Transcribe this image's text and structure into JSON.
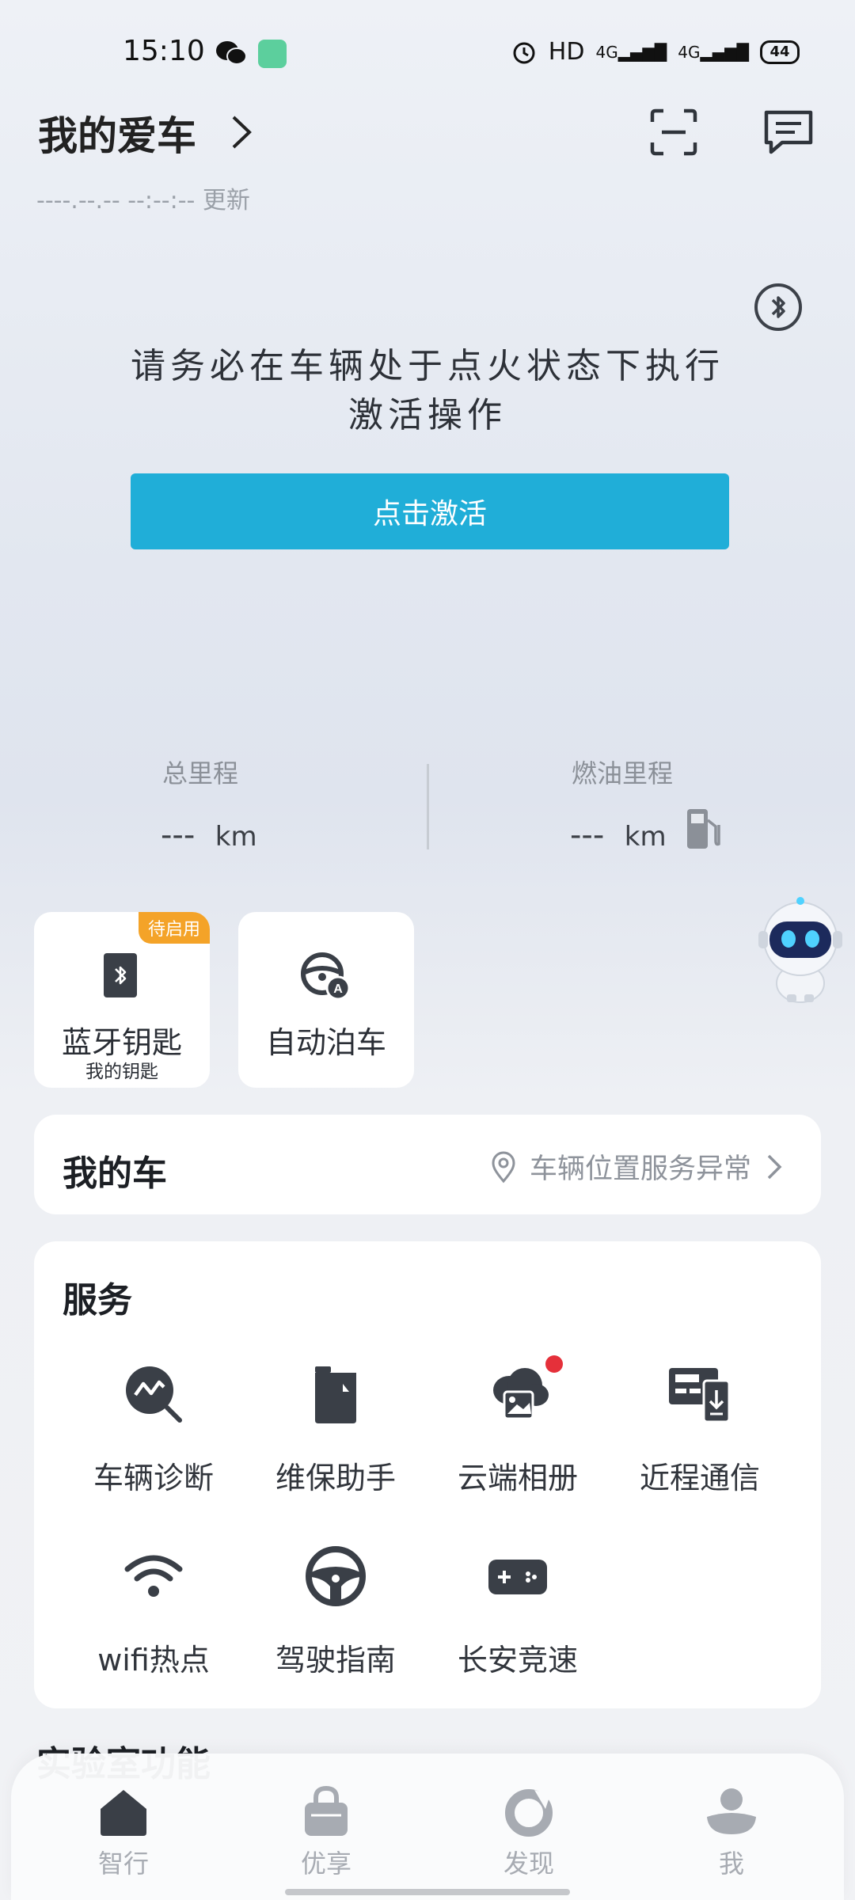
{
  "status_bar": {
    "time": "15:10",
    "network": "HD",
    "signal1": "4G",
    "signal2": "4G",
    "battery": "44"
  },
  "header": {
    "title": "我的爱车",
    "update_time": "----.--.-- --:--:-- 更新"
  },
  "activation": {
    "notice": "请务必在车辆处于点火状态下执行激活操作",
    "button": "点击激活"
  },
  "mileage": {
    "total": {
      "label": "总里程",
      "value": "---",
      "unit": "km"
    },
    "fuel": {
      "label": "燃油里程",
      "value": "---",
      "unit": "km"
    }
  },
  "quick_tiles": [
    {
      "label": "蓝牙钥匙",
      "sub": "我的钥匙",
      "badge": "待启用",
      "icon": "bluetooth-key-icon"
    },
    {
      "label": "自动泊车",
      "icon": "auto-parking-icon"
    }
  ],
  "my_car": {
    "title": "我的车",
    "location_status": "车辆位置服务异常"
  },
  "services": {
    "title": "服务",
    "items": [
      {
        "label": "车辆诊断",
        "icon": "diagnosis-icon"
      },
      {
        "label": "维保助手",
        "icon": "maintenance-icon"
      },
      {
        "label": "云端相册",
        "icon": "cloud-album-icon"
      },
      {
        "label": "近程通信",
        "icon": "nfc-icon"
      },
      {
        "label": "wifi热点",
        "icon": "wifi-icon"
      },
      {
        "label": "驾驶指南",
        "icon": "steering-wheel-icon"
      },
      {
        "label": "长安竞速",
        "icon": "gamepad-icon"
      }
    ]
  },
  "lab": {
    "title": "实验室功能"
  },
  "tabbar": [
    {
      "label": "智行",
      "icon": "home-icon"
    },
    {
      "label": "优享",
      "icon": "bag-icon"
    },
    {
      "label": "发现",
      "icon": "discover-icon"
    },
    {
      "label": "我",
      "icon": "profile-icon"
    }
  ],
  "colors": {
    "accent": "#20aed8",
    "badge": "#f4a328",
    "dot": "#e5303a",
    "icon": "#3a3f47"
  }
}
